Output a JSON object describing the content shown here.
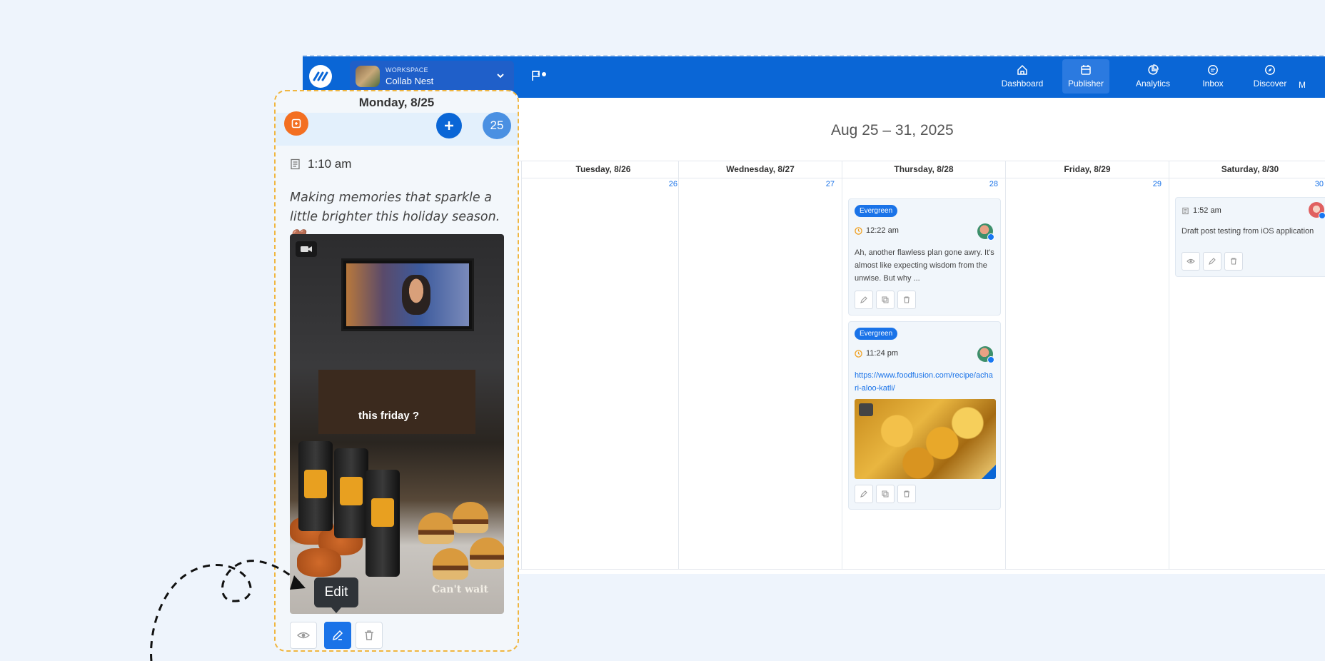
{
  "topbar": {
    "workspace_label": "WORKSPACE",
    "workspace_name": "Collab Nest",
    "nav": [
      {
        "label": "Dashboard",
        "icon": "home-icon"
      },
      {
        "label": "Publisher",
        "icon": "calendar-icon",
        "active": true
      },
      {
        "label": "Analytics",
        "icon": "pie-chart-icon"
      },
      {
        "label": "Inbox",
        "icon": "chat-icon"
      },
      {
        "label": "Discover",
        "icon": "compass-icon"
      },
      {
        "label": "M",
        "icon": ""
      }
    ]
  },
  "calendar": {
    "date_range": "Aug 25 – 31, 2025",
    "columns": [
      {
        "header": "Tuesday, 8/26",
        "day": "26"
      },
      {
        "header": "Wednesday, 8/27",
        "day": "27"
      },
      {
        "header": "Thursday, 8/28",
        "day": "28"
      },
      {
        "header": "Friday, 8/29",
        "day": "29"
      },
      {
        "header": "Saturday, 8/30",
        "day": "30"
      }
    ],
    "posts": [
      {
        "badge": "Evergreen",
        "time": "12:22 am",
        "text": "Ah, another flawless plan gone awry. It's almost like expecting wisdom from the unwise. But why ..."
      },
      {
        "badge": "Evergreen",
        "time": "11:24 pm",
        "link": "https://www.foodfusion.com/recipe/achari-aloo-katli/"
      },
      {
        "time": "1:52 am",
        "text": "Draft post testing from iOS application"
      }
    ]
  },
  "zoom": {
    "title": "Monday, 8/25",
    "day_number": "25",
    "time": "1:10 am",
    "caption": "Making memories that sparkle a little brighter this holiday season.🤎",
    "video_overlay_text": "this friday ?",
    "video_watermark": "Can't wait",
    "tooltip": "Edit"
  },
  "colors": {
    "brand": "#0a66d6",
    "accent": "#1a73e8",
    "highlight": "#f0b640"
  }
}
